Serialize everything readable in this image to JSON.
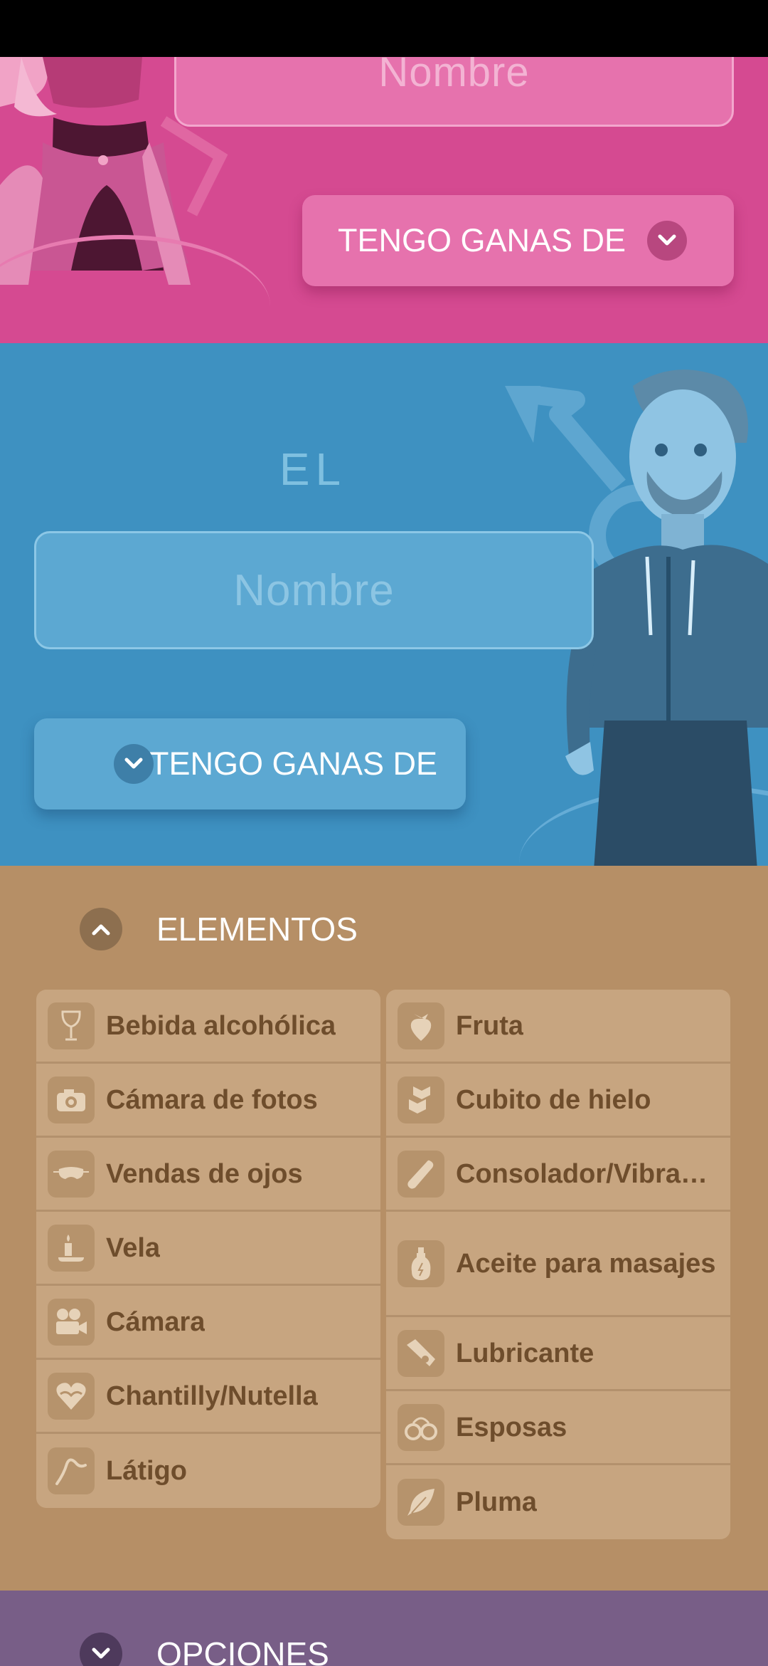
{
  "colors": {
    "pink": "#d54a91",
    "blue": "#3e91c1",
    "tan": "#b68f66",
    "purple": "#785e87"
  },
  "her": {
    "name_placeholder": "Nombre",
    "want_label": "TENGO GANAS DE",
    "chevron_icon": "chevron-down-icon"
  },
  "him": {
    "title": "EL",
    "name_placeholder": "Nombre",
    "want_label": "TENGO GANAS DE",
    "chevron_icon": "chevron-down-icon"
  },
  "elements": {
    "header": "ELEMENTOS",
    "toggle_icon": "chevron-up-icon",
    "left": [
      {
        "label": "Bebida alcohólica",
        "icon": "wine-glass-icon"
      },
      {
        "label": "Cámara de fotos",
        "icon": "photo-camera-icon"
      },
      {
        "label": "Vendas de ojos",
        "icon": "blindfold-icon"
      },
      {
        "label": "Vela",
        "icon": "candle-icon"
      },
      {
        "label": "Cámara",
        "icon": "video-camera-icon"
      },
      {
        "label": "Chantilly/Nutella",
        "icon": "heart-cream-icon"
      },
      {
        "label": "Látigo",
        "icon": "whip-icon"
      }
    ],
    "right": [
      {
        "label": "Fruta",
        "icon": "strawberry-icon"
      },
      {
        "label": "Cubito de hielo",
        "icon": "ice-cube-icon"
      },
      {
        "label": "Consolador/Vibra…",
        "icon": "vibrator-icon"
      },
      {
        "label": "Aceite para masajes",
        "icon": "oil-bottle-icon"
      },
      {
        "label": "Lubricante",
        "icon": "lubricant-tube-icon"
      },
      {
        "label": "Esposas",
        "icon": "handcuffs-icon"
      },
      {
        "label": "Pluma",
        "icon": "feather-icon"
      }
    ]
  },
  "options": {
    "header": "OPCIONES",
    "toggle_icon": "chevron-down-icon"
  }
}
